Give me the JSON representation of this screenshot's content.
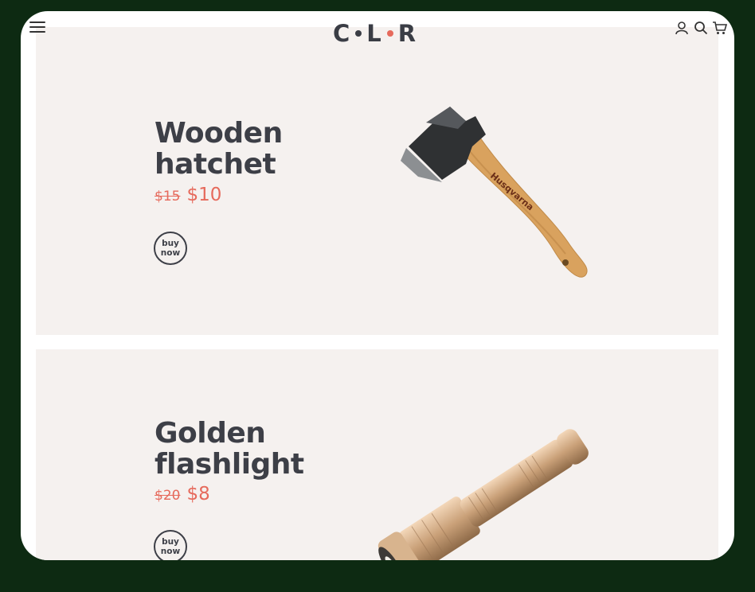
{
  "header": {
    "logo": {
      "letters": [
        "C",
        "L",
        "R"
      ],
      "dot_colors": [
        "#3a3d45",
        "#e66a5c"
      ]
    },
    "icons": [
      "menu-icon",
      "user-icon",
      "search-icon",
      "cart-icon"
    ]
  },
  "products": [
    {
      "title": "Wooden hatchet",
      "old_price": "$15",
      "new_price": "$10",
      "button_label": "buy\nnow",
      "image": "hatchet"
    },
    {
      "title": "Golden flashlight",
      "old_price": "$20",
      "new_price": "$8",
      "button_label": "buy\nnow",
      "image": "flashlight"
    }
  ],
  "colors": {
    "accent": "#e66a5c",
    "text": "#3d3f47",
    "card_bg": "#f5f1ef"
  }
}
